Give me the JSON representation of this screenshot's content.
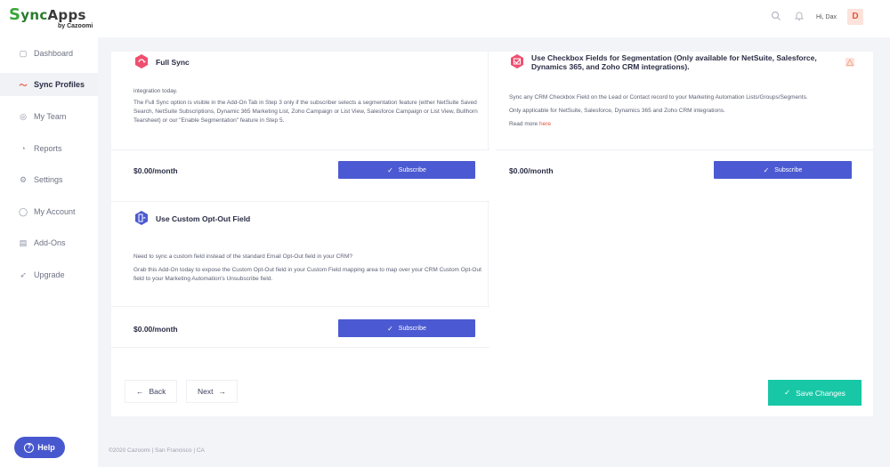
{
  "header": {
    "logo_main_s": "S",
    "logo_main_rest": "ync",
    "logo_main_apps": "Apps",
    "logo_sub": "by Cazoomi",
    "greeting": "Hi, Dax",
    "avatar_initial": "D",
    "icons": [
      "search-icon",
      "bell-icon"
    ]
  },
  "sidebar": {
    "items": [
      {
        "label": "Dashboard",
        "icon": "dashboard-icon",
        "glyph": "▢"
      },
      {
        "label": "Sync Profiles",
        "icon": "sync-icon",
        "glyph": "〜"
      },
      {
        "label": "My Team",
        "icon": "team-icon",
        "glyph": "◎"
      },
      {
        "label": "Reports",
        "icon": "reports-icon",
        "glyph": "◔"
      },
      {
        "label": "Settings",
        "icon": "settings-icon",
        "glyph": "⚙"
      },
      {
        "label": "My Account",
        "icon": "account-icon",
        "glyph": "◯"
      },
      {
        "label": "Add-Ons",
        "icon": "addons-icon",
        "glyph": "▤"
      },
      {
        "label": "Upgrade",
        "icon": "upgrade-icon",
        "glyph": "➶"
      }
    ],
    "active": "Sync Profiles",
    "help_label": "Help"
  },
  "cards": {
    "full_sync": {
      "title": "Full Sync",
      "body_line0": "integration today.",
      "body": "The Full Sync option is visible in the Add-On Tab in Step 3 only if the subscriber selects a segmentation feature (either NetSuite Saved Search, NetSuite Subscriptions, Dynamic 365 Marketing List, Zoho Campaign or List View, Salesforce Campaign or List View, Bullhorn Tearsheet) or our \"Enable Segmentation\" feature in Step 5.",
      "price": "$0.00/month",
      "button": "Subscribe"
    },
    "checkbox": {
      "title": "Use Checkbox Fields for Segmentation (Only available for NetSuite, Salesforce, Dynamics 365, and Zoho CRM integrations).",
      "body1": "Sync any CRM Checkbox Field on the Lead or Contact record to your Marketing Automation Lists/Groups/Segments.",
      "body2": "Only applicable for NetSuite, Salesforce, Dynamics 365 and Zoho CRM integrations.",
      "read_more": "Read more",
      "here": "here",
      "price": "$0.00/month",
      "button": "Subscribe"
    },
    "opt_out": {
      "title": "Use Custom Opt-Out Field",
      "body1": "Need to sync a custom field instead of the standard Email Opt-Out field in your CRM?",
      "body2": "Grab this Add-On today to expose the Custom Opt-Out field in your Custom Field mapping area to map over your CRM Custom Opt-Out field to your Marketing Automation's Unsubscribe field.",
      "price": "$0.00/month",
      "button": "Subscribe"
    }
  },
  "nav": {
    "back": "Back",
    "next": "Next",
    "save": "Save Changes"
  },
  "footer": "©2020 Cazoomi | San Francisco | CA",
  "colors": {
    "primary": "#4b5ad2",
    "accent": "#e2563b",
    "save": "#17c7a6"
  }
}
